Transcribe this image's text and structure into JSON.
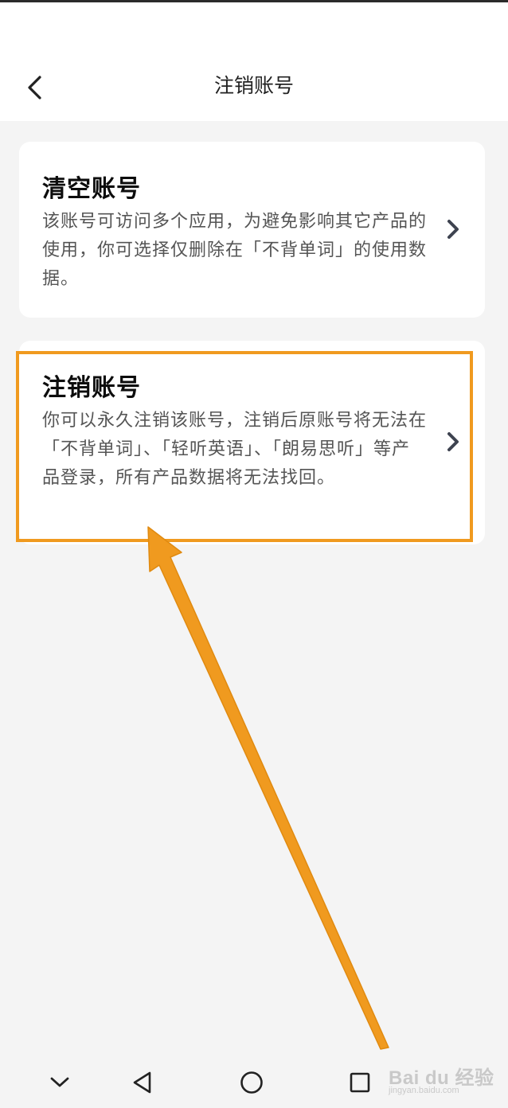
{
  "header": {
    "title": "注销账号",
    "back_icon": "chevron-left-icon"
  },
  "options": [
    {
      "title": "清空账号",
      "description": "该账号可访问多个应用，为避免影响其它产品的使用，你可选择仅删除在「不背单词」的使用数据。"
    },
    {
      "title": "注销账号",
      "description": "你可以永久注销该账号，注销后原账号将无法在「不背单词」、「轻听英语」、「朗易思听」等产品登录，所有产品数据将无法找回。"
    }
  ],
  "annotation": {
    "highlight_color": "#f09a1f",
    "arrow_color": "#f09a1f"
  },
  "nav_bar": {
    "icons": [
      "chevron-down-icon",
      "back-triangle-icon",
      "home-circle-icon",
      "recents-square-icon"
    ]
  },
  "watermark": {
    "logo": "Bai du 经验",
    "url": "jingyan.baidu.com"
  },
  "colors": {
    "background": "#f4f4f4",
    "card": "#ffffff",
    "text_primary": "#0d0d0d",
    "text_secondary": "#555555",
    "accent": "#f09a1f"
  }
}
